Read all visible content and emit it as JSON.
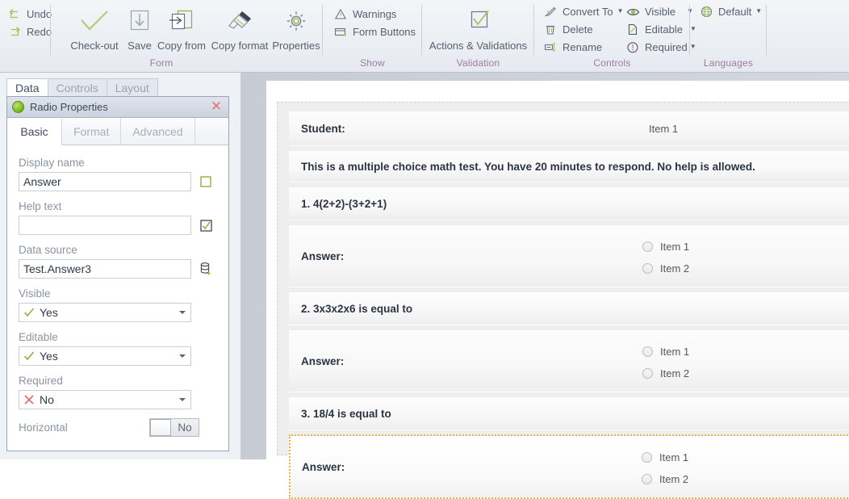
{
  "ribbon": {
    "groups": [
      {
        "caption": "Form",
        "small": [
          {
            "label": "Undo",
            "icon": "undo-icon"
          },
          {
            "label": "Redo",
            "icon": "redo-icon"
          }
        ],
        "big": [
          {
            "label": "Check-out",
            "icon": "checkmark-icon"
          },
          {
            "label": "Save",
            "icon": "save-download-icon"
          },
          {
            "label": "Copy from",
            "icon": "copy-from-icon"
          },
          {
            "label": "Copy format",
            "icon": "paintbrush-icon"
          },
          {
            "label": "Properties",
            "icon": "gear-icon"
          }
        ]
      },
      {
        "caption": "Show",
        "small": [
          {
            "label": "Warnings",
            "icon": "warning-triangle-icon"
          },
          {
            "label": "Form Buttons",
            "icon": "form-buttons-icon"
          }
        ],
        "big": []
      },
      {
        "caption": "Validation",
        "small": [],
        "big": [
          {
            "label": "Actions & Validations",
            "icon": "check-box-icon"
          }
        ]
      },
      {
        "caption": "Controls",
        "small": [
          {
            "label": "Convert To",
            "icon": "convert-to-icon",
            "caret": true
          },
          {
            "label": "Delete",
            "icon": "trash-icon"
          },
          {
            "label": "Rename",
            "icon": "rename-icon"
          }
        ],
        "small2": [
          {
            "label": "Visible",
            "icon": "eye-icon",
            "caret": true
          },
          {
            "label": "Editable",
            "icon": "edit-page-icon",
            "caret": true
          },
          {
            "label": "Required",
            "icon": "exclamation-circle-icon",
            "caret": true
          }
        ],
        "big": []
      },
      {
        "caption": "Languages",
        "small": [
          {
            "label": "Default",
            "icon": "globe-icon",
            "caret": true
          }
        ],
        "big": []
      }
    ]
  },
  "left_panel": {
    "tabs": [
      {
        "label": "Data",
        "active": true
      },
      {
        "label": "Controls",
        "active": false
      },
      {
        "label": "Layout",
        "active": false
      }
    ],
    "properties": {
      "title": "Radio Properties",
      "close_label": "✕",
      "status_color": "#7cbb2a",
      "subtabs": [
        {
          "label": "Basic",
          "active": true
        },
        {
          "label": "Format",
          "active": false
        },
        {
          "label": "Advanced",
          "active": false
        }
      ],
      "fields": {
        "display_name": {
          "label": "Display name",
          "value": "Answer",
          "placeholder": "",
          "toggle_icon": "empty-checkbox-icon"
        },
        "help_text": {
          "label": "Help text",
          "value": "",
          "placeholder": "",
          "toggle_icon": "checked-checkbox-icon"
        },
        "data_source": {
          "label": "Data source",
          "value": "Test.Answer3",
          "placeholder": "",
          "trail_icon": "database-add-icon"
        },
        "visible": {
          "label": "Visible",
          "value": "Yes",
          "mark": "check"
        },
        "editable": {
          "label": "Editable",
          "value": "Yes",
          "mark": "check"
        },
        "required": {
          "label": "Required",
          "value": "No",
          "mark": "cross"
        },
        "horizontal": {
          "label": "Horizontal",
          "value": "No"
        }
      }
    }
  },
  "form_preview": {
    "rows": [
      {
        "type": "head",
        "label": "Student:",
        "value": "Item 1"
      },
      {
        "type": "note",
        "text": "This is a multiple choice math test. You have 20 minutes to respond. No help is allowed."
      },
      {
        "type": "question",
        "text": "1. 4(2+2)-(3+2+1)"
      },
      {
        "type": "answer",
        "label": "Answer:",
        "options": [
          "Item 1",
          "Item 2"
        ],
        "selected": false
      },
      {
        "type": "question",
        "text": "2. 3x3x2x6 is equal to"
      },
      {
        "type": "answer",
        "label": "Answer:",
        "options": [
          "Item 1",
          "Item 2"
        ],
        "selected": false
      },
      {
        "type": "question",
        "text": "3. 18/4 is equal to"
      },
      {
        "type": "answer",
        "label": "Answer:",
        "options": [
          "Item 1",
          "Item 2"
        ],
        "selected": true
      }
    ],
    "selection_color": "#e8b340"
  }
}
